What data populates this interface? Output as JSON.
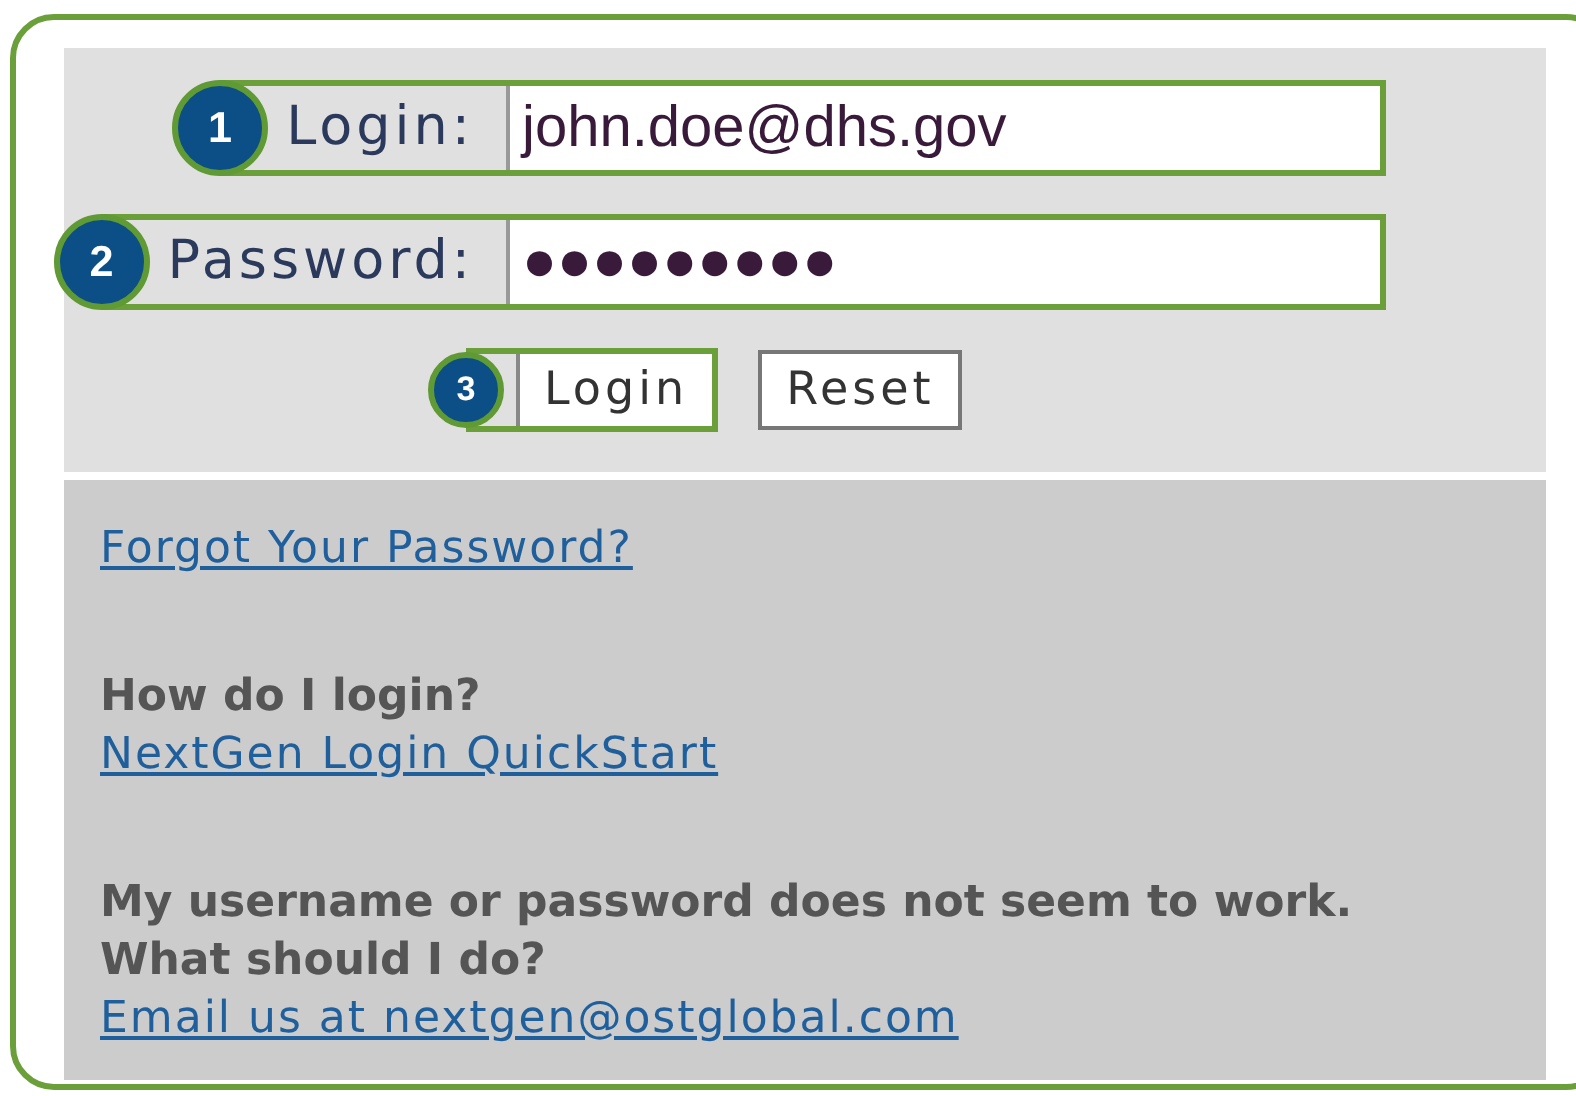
{
  "login_form": {
    "fields": [
      {
        "badge": "1",
        "label": "Login:",
        "value": "john.doe@dhs.gov"
      },
      {
        "badge": "2",
        "label": "Password:",
        "value": "●●●●●●●●●"
      }
    ],
    "buttons": [
      {
        "label": "Login",
        "badge": "3"
      },
      {
        "label": "Reset"
      }
    ]
  },
  "help": {
    "forgot_link": "Forgot Your Password?",
    "sections": [
      {
        "question": "How do I login?",
        "link": "NextGen Login QuickStart"
      },
      {
        "question": "My username or password does not seem to work. What should I do?",
        "link": "Email us at nextgen@ostglobal.com"
      }
    ]
  }
}
